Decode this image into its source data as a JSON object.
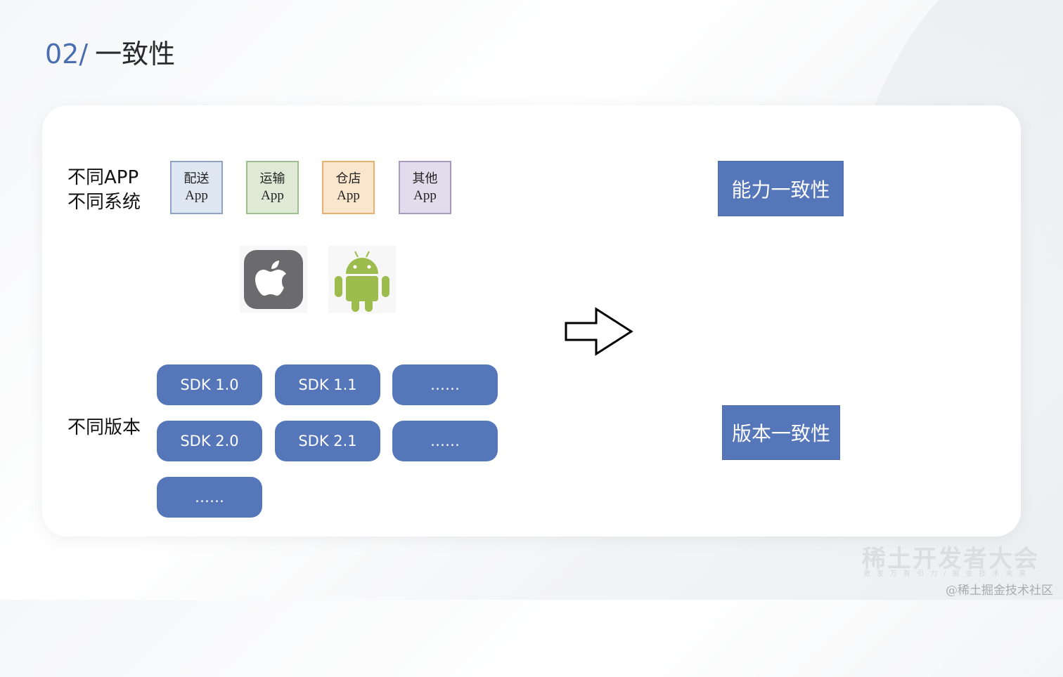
{
  "header": {
    "number": "02/",
    "title": "一致性"
  },
  "left": {
    "apps_label_line1": "不同APP",
    "apps_label_line2": "不同系统",
    "versions_label": "不同版本"
  },
  "apps": [
    {
      "name": "配送",
      "suffix": "App",
      "bg": "#dee6f2",
      "border": "#8ea3c6"
    },
    {
      "name": "运输",
      "suffix": "App",
      "bg": "#dfead6",
      "border": "#9fc08d"
    },
    {
      "name": "仓店",
      "suffix": "App",
      "bg": "#fae6cd",
      "border": "#e4b373"
    },
    {
      "name": "其他",
      "suffix": "App",
      "bg": "#e2dcec",
      "border": "#a79bbf"
    }
  ],
  "os_icons": [
    {
      "name": "apple-icon",
      "color": "#6b6b6d"
    },
    {
      "name": "android-icon",
      "color": "#9cbd4e"
    }
  ],
  "sdks": {
    "row1": [
      "SDK 1.0",
      "SDK 1.1",
      "……"
    ],
    "row2": [
      "SDK 2.0",
      "SDK 2.1",
      "……"
    ],
    "row3": [
      "……"
    ]
  },
  "results": {
    "capability": "能力一致性",
    "version": "版本一致性"
  },
  "colors": {
    "accent": "#5576b8",
    "title_number": "#4a6fb0"
  },
  "watermark": {
    "brand": "稀土开发者大会",
    "slogan": "激发万有引力/掘金技术未来",
    "credit": "@稀土掘金技术社区"
  }
}
